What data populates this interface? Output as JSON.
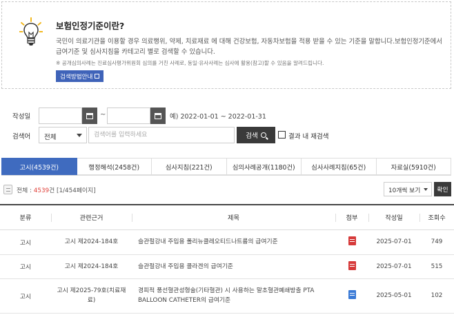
{
  "info": {
    "title": "보험인정기준이란?",
    "description": "국민이 의료기관을 이용할 경우 의료행위, 약제, 치료재료 에 대해 건강보험, 자동차보험을 적용 받을 수 있는 기준을 말합니다.보험인정기준에서 급여기준 및 심사지침을 카테고리 별로 검색할 수 있습니다.",
    "note": "※ 공개심의사례는 진료심사평가위원회 심의를 거친 사례로, 동일·유사사례는 심사에 활용(참고)할 수 있음을 알려드립니다.",
    "guide_button": "검색방법안내"
  },
  "search": {
    "date_label": "작성일",
    "date_from": "",
    "date_to": "",
    "tilde": "~",
    "date_example": "예) 2022-01-01 ~ 2022-01-31",
    "keyword_label": "검색어",
    "scope_selected": "전체",
    "keyword_placeholder": "검색어를 입력하세요",
    "search_button": "검색",
    "within_label": "결과 내 재검색"
  },
  "tabs": [
    {
      "label": "고시(4539건)",
      "active": true
    },
    {
      "label": "행정해석(2458건)",
      "active": false
    },
    {
      "label": "심사지침(221건)",
      "active": false
    },
    {
      "label": "심의사례공개(1180건)",
      "active": false
    },
    {
      "label": "심사사례지침(65건)",
      "active": false
    },
    {
      "label": "자료실(5910건)",
      "active": false
    }
  ],
  "results": {
    "prefix": "전체 : ",
    "count": "4539",
    "suffix": "건 [1/454페이지]",
    "per_page": "10개씩 보기",
    "confirm": "확인"
  },
  "table": {
    "headers": [
      "분류",
      "관련근거",
      "제목",
      "첨부",
      "작성일",
      "조회수"
    ],
    "rows": [
      {
        "category": "고시",
        "basis": "고시 제2024-184호",
        "title": "슬관절강내 주입용 폴리뉴클레오티드나트륨의 급여기준",
        "attach": "pdf",
        "date": "2025-07-01",
        "views": "749"
      },
      {
        "category": "고시",
        "basis": "고시 제2024-184호",
        "title": "슬관절강내 주입용 콜라겐의 급여기준",
        "attach": "pdf",
        "date": "2025-07-01",
        "views": "515"
      },
      {
        "category": "고시",
        "basis": "고시 제2025-79호(치료재료)",
        "title": "경피적 풍선혈관성형술(기타혈관) 시 사용하는 말초혈관폐쇄방출 PTA BALLOON CATHETER의 급여기준",
        "attach": "doc",
        "date": "2025-05-01",
        "views": "102"
      }
    ]
  }
}
